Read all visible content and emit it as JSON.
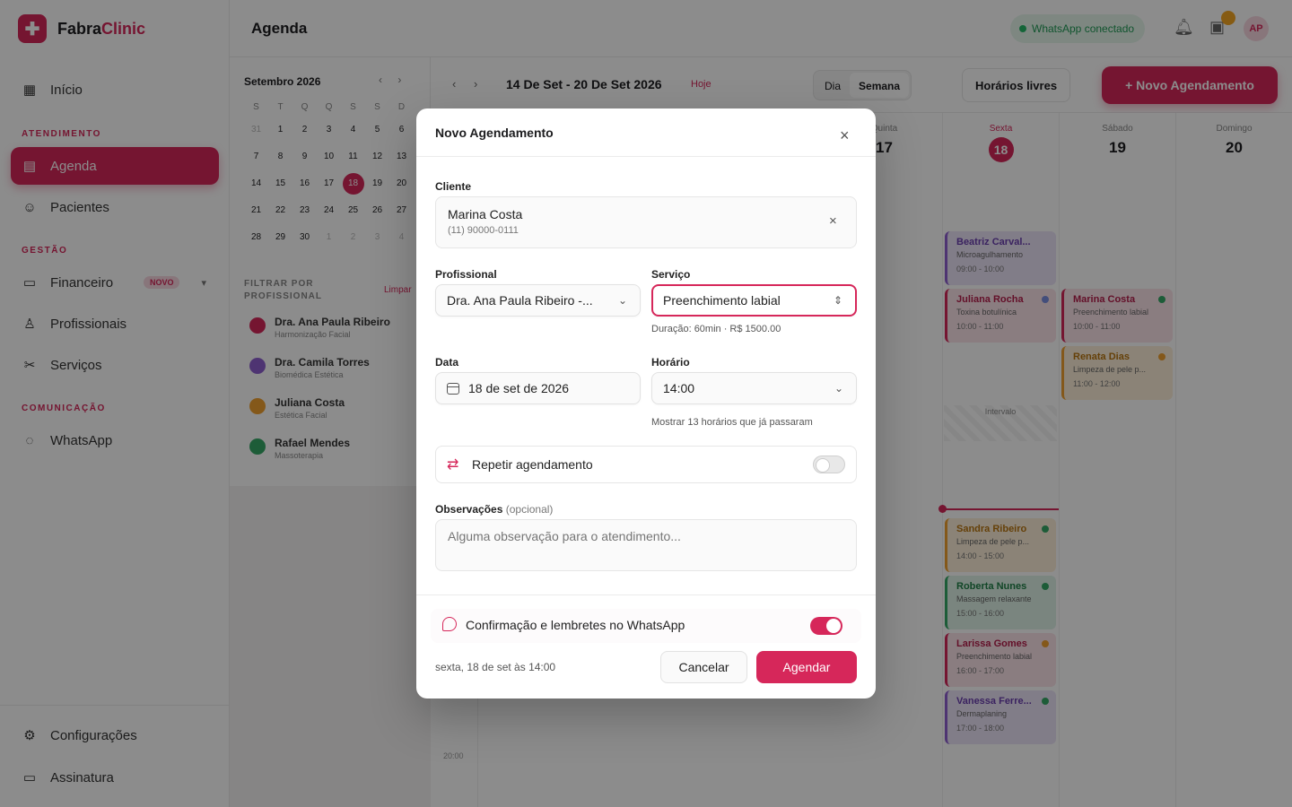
{
  "app": {
    "brand_a": "Fabra",
    "brand_b": "Clinic",
    "brand_color": "#d6275a"
  },
  "sidebar": {
    "home": "Início",
    "section_atendimento": "ATENDIMENTO",
    "agenda": "Agenda",
    "pacientes": "Pacientes",
    "section_gestao": "GESTÃO",
    "financeiro": "Financeiro",
    "financeiro_badge": "NOVO",
    "profissionais": "Profissionais",
    "servicos": "Serviços",
    "section_comunicacao": "COMUNICAÇÃO",
    "whatsapp": "WhatsApp",
    "configuracoes": "Configurações",
    "assinatura": "Assinatura"
  },
  "header": {
    "title": "Agenda",
    "whatsapp_status": "WhatsApp conectado",
    "avatar_initials": "AP"
  },
  "mini_calendar": {
    "month": "Setembro 2026",
    "weekdays": [
      "S",
      "T",
      "Q",
      "Q",
      "S",
      "S",
      "D"
    ],
    "filter_title": "FILTRAR POR PROFISSIONAL",
    "filter_clear": "Limpar",
    "professionals": [
      {
        "name": "Dra. Ana Paula Ribeiro",
        "role": "Harmonização Facial",
        "color": "#d6275a"
      },
      {
        "name": "Dra. Camila Torres",
        "role": "Biomédica Estética",
        "color": "#8e5fd0"
      },
      {
        "name": "Juliana Costa",
        "role": "Estética Facial",
        "color": "#f0a030"
      },
      {
        "name": "Rafael Mendes",
        "role": "Massoterapia",
        "color": "#35a866"
      }
    ]
  },
  "week": {
    "range": "14 De Set - 20 De Set 2026",
    "today_link": "Hoje",
    "view_day": "Dia",
    "view_week": "Semana",
    "free_slots": "Horários livres",
    "new_button": "+  Novo Agendamento",
    "days": [
      {
        "wd": "Quinta",
        "dn": "17"
      },
      {
        "wd": "Sexta",
        "dn": "18"
      },
      {
        "wd": "Sábado",
        "dn": "19"
      },
      {
        "wd": "Domingo",
        "dn": "20"
      }
    ],
    "appointments": [
      {
        "name": "Beatriz Carval...",
        "service": "Microagulhamento",
        "time": "09:00 - 10:00",
        "color": "purple"
      },
      {
        "name": "Juliana Rocha",
        "service": "Toxina botulínica",
        "time": "10:00 - 11:00",
        "color": "pink"
      },
      {
        "name": "Marina Costa",
        "service": "Preenchimento labial",
        "time": "10:00 - 11:00",
        "color": "pink"
      },
      {
        "name": "Renata Dias",
        "service": "Limpeza de pele p...",
        "time": "11:00 - 12:00",
        "color": "orange"
      },
      {
        "name": "Sandra Ribeiro",
        "service": "Limpeza de pele p...",
        "time": "14:00 - 15:00",
        "color": "orange"
      },
      {
        "name": "Roberta Nunes",
        "service": "Massagem relaxante",
        "time": "15:00 - 16:00",
        "color": "green"
      },
      {
        "name": "Larissa Gomes",
        "service": "Preenchimento labial",
        "time": "16:00 - 17:00",
        "color": "pink"
      },
      {
        "name": "Vanessa Ferre...",
        "service": "Dermaplaning",
        "time": "17:00 - 18:00",
        "color": "purple"
      }
    ],
    "interval_label": "Intervalo",
    "time_label": "20:00"
  },
  "modal": {
    "title": "Novo Agendamento",
    "client_label": "Cliente",
    "client_name": "Marina Costa",
    "client_phone": "(11) 90000-0111",
    "professional_label": "Profissional",
    "professional_value": "Dra. Ana Paula Ribeiro -...",
    "service_label": "Serviço",
    "service_value": "Preenchimento labial",
    "service_hint": "Duração: 60min · R$ 1500.00",
    "date_label": "Data",
    "date_value": "18 de set de 2026",
    "time_label": "Horário",
    "time_value": "14:00",
    "time_hint": "Mostrar 13 horários que já passaram",
    "repeat_label": "Repetir agendamento",
    "notes_label": "Observações",
    "notes_optional": "(opcional)",
    "notes_placeholder": "Alguma observação para o atendimento...",
    "whatsapp_label": "Confirmação e lembretes no WhatsApp",
    "summary": "sexta, 18 de set às 14:00",
    "cancel": "Cancelar",
    "submit": "Agendar"
  }
}
